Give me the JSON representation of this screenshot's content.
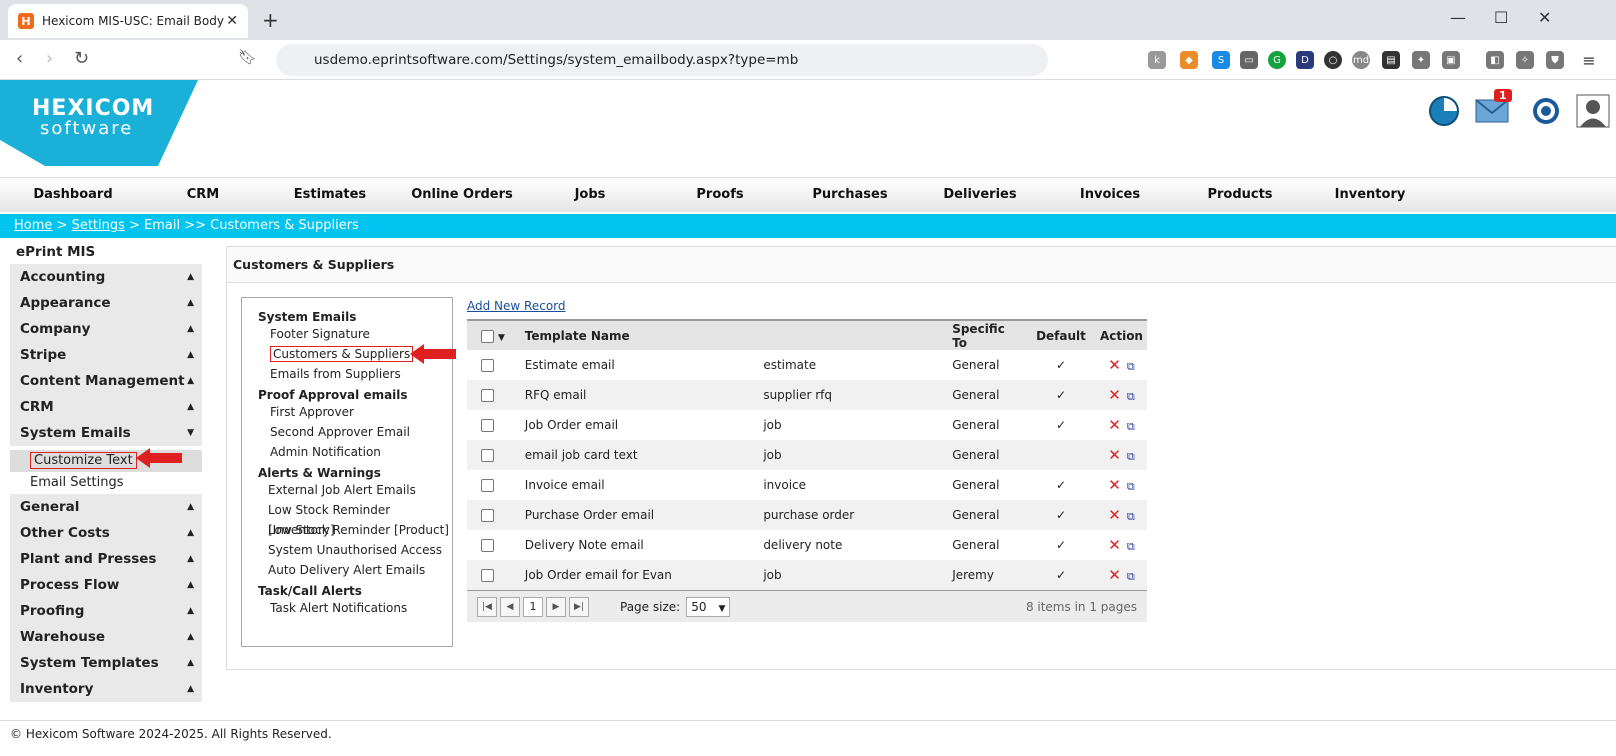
{
  "browser": {
    "tab_title": "Hexicom MIS-USC: Email Body",
    "tab_favicon": "H",
    "url": "usdemo.eprintsoftware.com/Settings/system_emailbody.aspx?type=mb"
  },
  "header": {
    "logo_line1": "HEXICOM",
    "logo_line2": "software",
    "mail_badge": "1"
  },
  "mainnav": [
    "Dashboard",
    "CRM",
    "Estimates",
    "Online Orders",
    "Jobs",
    "Proofs",
    "Purchases",
    "Deliveries",
    "Invoices",
    "Products",
    "Inventory"
  ],
  "breadcrumb": {
    "home": "Home",
    "sep1": " > ",
    "settings": "Settings",
    "rest": " > Email >> Customers & Suppliers"
  },
  "sidebar": {
    "title": "ePrint MIS",
    "sections_top": [
      "Accounting",
      "Appearance",
      "Company",
      "Stripe",
      "Content Management",
      "CRM",
      "System Emails"
    ],
    "sub_items": [
      "Customize Text",
      "Email Settings"
    ],
    "sections_bottom": [
      "General",
      "Other Costs",
      "Plant and Presses",
      "Process Flow",
      "Proofing",
      "Warehouse",
      "System Templates",
      "Inventory"
    ]
  },
  "panel": {
    "title": "Customers & Suppliers"
  },
  "tree": {
    "groups": [
      {
        "label": "System Emails",
        "items": [
          "Footer Signature",
          "Customers & Suppliers",
          "Emails from Suppliers"
        ]
      },
      {
        "label": "Proof Approval emails",
        "items": [
          "First Approver",
          "Second Approver Email",
          "Admin Notification"
        ]
      },
      {
        "label": "Alerts & Warnings",
        "items": [
          "External Job Alert Emails",
          "Low Stock Reminder [Inventory]",
          "Low Stock Reminder [Product]",
          "System Unauthorised Access",
          "Auto Delivery Alert Emails"
        ]
      },
      {
        "label": "Task/Call Alerts",
        "items": [
          "Task Alert Notifications"
        ]
      }
    ]
  },
  "grid": {
    "add_new": "Add New Record",
    "columns": [
      "Template Name",
      "",
      "Specific To",
      "Default",
      "Action"
    ],
    "rows": [
      {
        "name": "Estimate email",
        "type": "estimate",
        "specific": "General",
        "default": "✓"
      },
      {
        "name": "RFQ email",
        "type": "supplier rfq",
        "specific": "General",
        "default": "✓"
      },
      {
        "name": "Job Order email",
        "type": "job",
        "specific": "General",
        "default": "✓"
      },
      {
        "name": "email job card text",
        "type": "job",
        "specific": "General",
        "default": ""
      },
      {
        "name": "Invoice email",
        "type": "invoice",
        "specific": "General",
        "default": "✓"
      },
      {
        "name": "Purchase Order email",
        "type": "purchase order",
        "specific": "General",
        "default": "✓"
      },
      {
        "name": "Delivery Note email",
        "type": "delivery note",
        "specific": "General",
        "default": "✓"
      },
      {
        "name": "Job Order email for Evan",
        "type": "job",
        "specific": "Jeremy",
        "default": "✓"
      }
    ],
    "pager": {
      "page": "1",
      "page_size_label": "Page size:",
      "page_size": "50",
      "summary": "8 items in 1 pages"
    }
  },
  "footer": {
    "text": "© Hexicom Software 2024-2025. All Rights Reserved."
  },
  "colors": {
    "accent": "#00c4f0",
    "logo": "#1ab0d8",
    "arrow": "#e02020"
  }
}
